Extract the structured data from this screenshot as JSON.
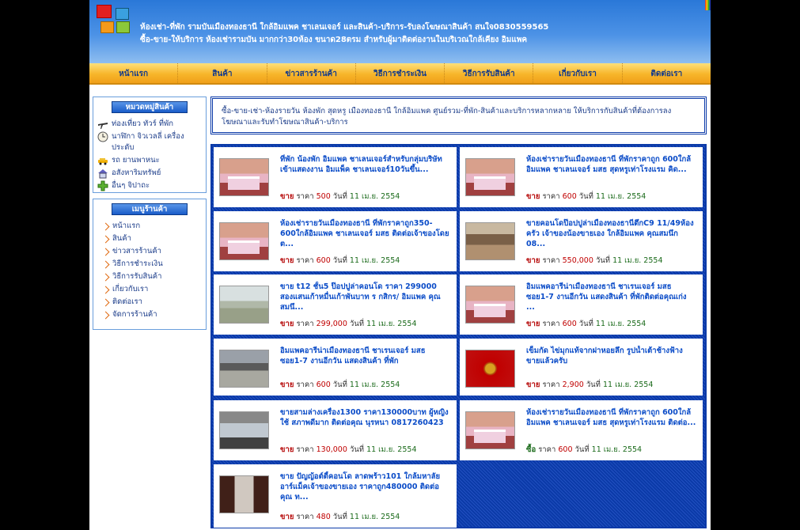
{
  "header": {
    "line1": "ห้องเช่า-ที่พัก รามบันเมืองทองธานี ใกล้อิมแพค ชาเลนเจอร์ และสินค้า-บริการ-รับลงโฆษณาสินค้า สนใจ0830559565",
    "line2": "ซื้อ-ขาย-ให้บริการ ห้องเช่ารามบัน มากกว่า30ห้อง ขนาด28ตรม สำหรับผู้มาติดต่องานในบริเวณใกล้เคียง อิมแพค"
  },
  "nav": [
    "หน้าแรก",
    "สินค้า",
    "ข่าวสารร้านค้า",
    "วิธีการชำระเงิน",
    "วิธีการรับสินค้า",
    "เกี่ยวกับเรา",
    "ติดต่อเรา"
  ],
  "categories": {
    "title": "หมวดหมู่สินค้า",
    "items": [
      {
        "label": "ท่องเที่ยว ทัวร์ ที่พัก",
        "icon": "airplane-icon"
      },
      {
        "label": "นาฬิกา จิวเวลลี่ เครื่องประดับ",
        "icon": "clock-icon"
      },
      {
        "label": "รถ ยานพาหนะ",
        "icon": "car-icon"
      },
      {
        "label": "อสังหาริมทรัพย์",
        "icon": "house-icon"
      },
      {
        "label": "อื่นๆ จิปาถะ",
        "icon": "plus-icon"
      }
    ]
  },
  "menu": {
    "title": "เมนูร้านค้า",
    "items": [
      "หน้าแรก",
      "สินค้า",
      "ข่าวสารร้านค้า",
      "วิธีการชำระเงิน",
      "วิธีการรับสินค้า",
      "เกี่ยวกับเรา",
      "ติดต่อเรา",
      "จัดการร้านค้า"
    ]
  },
  "intro": "ซื้อ-ขาย-เช่า-ห้องรายวัน ห้องพัก สุดหรู เมืองทองธานี ใกล้อิมแพค ศูนย์รวม-ที่พัก-สินค้าและบริการหลากหลาย ให้บริการกับสินค้าที่ต้องการลงโฆษณาและรับทำโฆษณาสินค้า-บริการ",
  "labels": {
    "price": "ราคา",
    "date_prefix": "วันที่"
  },
  "listings": [
    {
      "title": "ที่พัก น้องพัก อิมแพค ชาเลนเจอร์สำหรับกลุ่มบริษัทเข้าแสดงงาน อิมแพ็ค ชาเลนเจอร์10วันขึ้น...",
      "kind": "ขาย",
      "price": "500",
      "date": "11 เม.ย. 2554",
      "img": "bedroom"
    },
    {
      "title": "ห้องเช่ารายวันเมืองทองธานี ที่พักราคาถูก 600ใกล้อิมแพค ชาเลนเจอร์ มสธ สุดหรูเท่าโรงแรม คิด...",
      "kind": "ขาย",
      "price": "600",
      "date": "11 เม.ย. 2554",
      "img": "bedroom"
    },
    {
      "title": "ห้องเช่ารายวันเมืองทองธานี ที่พักราคาถูก350-600ใกล้อิมแพค ชาเลนเจอร์ มสธ ติดต่อเจ้าของโดยต...",
      "kind": "ขาย",
      "price": "600",
      "date": "11 เม.ย. 2554",
      "img": "bedroom"
    },
    {
      "title": "ขายคอนโดป๊อปปูล่าเมืองทองธานีตึกC9 11/49ห้องครัว เจ้าของน้องขายเอง ใกล้อิมแพค คุณสมนึก 08...",
      "kind": "ขาย",
      "price": "550,000",
      "date": "11 เม.ย. 2554",
      "img": "lobby"
    },
    {
      "title": "ขาย t12 ชั้น5 ป๊อปปูล่าคอนโด ราคา 299000 สองแสนเก้าหมื่นเก้าพันบาท ร กสิกร/ อิมแพค คุณสมนึ...",
      "kind": "ขาย",
      "price": "299,000",
      "date": "11 เม.ย. 2554",
      "img": "aerial"
    },
    {
      "title": "อิมแพคอารีน่าเมืองทองธานี ชาเรนเจอร์ มสธ ซอย1-7 งานอีกวัน แสดงสินค้า ที่พักติดต่อคุณเก่ง ...",
      "kind": "ขาย",
      "price": "600",
      "date": "11 เม.ย. 2554",
      "img": "bedroom"
    },
    {
      "title": "อิมแพคอารีน่าเมืองทองธานี ชาเรนเจอร์ มสธ ซอย1-7 งานอีกวัน แสดงสินค้า ที่พัก",
      "kind": "ขาย",
      "price": "600",
      "date": "11 เม.ย. 2554",
      "img": "parking"
    },
    {
      "title": "เข็มกัด ไข่มุกแท้จากฝาหอยลึก รูปน้ำเต้าช้างฟ้าง ขายแล้วครับ",
      "kind": "ขาย",
      "price": "2,900",
      "date": "11 เม.ย. 2554",
      "img": "gourd"
    },
    {
      "title": "ขายสามล่างเครื่อง1300 ราคา130000บาท ผู้หญิงใช้ สภาพดีมาก ติดต่อคุณ นุรหนา 0817260423",
      "kind": "ขาย",
      "price": "130,000",
      "date": "11 เม.ย. 2554",
      "img": "car"
    },
    {
      "title": "ห้องเช่ารายวันเมืองทองธานี ที่พักราคาถูก 600ใกล้อิมแพค ชาเลนเจอร์ มสธ สุดหรูเท่าโรงแรม ติดต่อ...",
      "kind": "ซื้อ",
      "price": "600",
      "date": "11 เม.ย. 2554",
      "img": "bedroom"
    },
    {
      "title": "ขาย ปัญญ้อต์ตี้คอนโด ลาดพร้าว101 ใกล้มหาลัย อาร์แม็คเจ้าของขายเอง ราคาถูก480000 ติดต่อคุณ ท...",
      "kind": "ขาย",
      "price": "480",
      "date": "11 เม.ย. 2554",
      "img": "hall"
    }
  ]
}
